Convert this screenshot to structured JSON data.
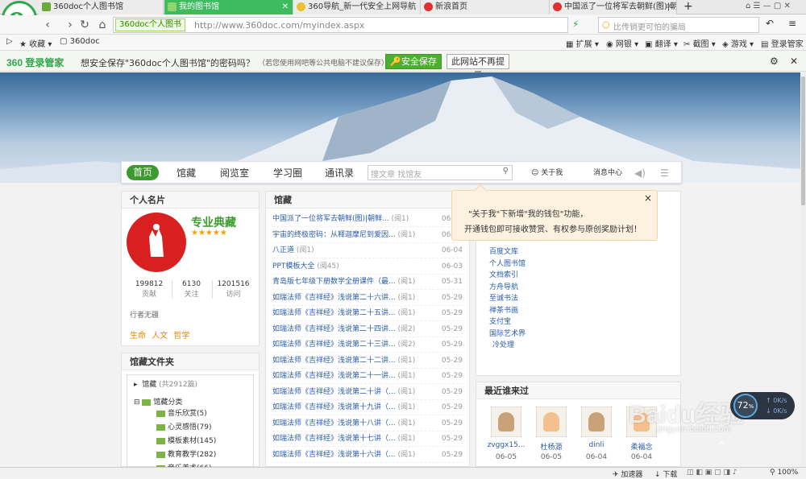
{
  "tabs": [
    {
      "label": "360doc个人图书馆",
      "active": false
    },
    {
      "label": "我的图书馆",
      "active": true
    },
    {
      "label": "360导航_新一代安全上网导航",
      "active": false
    },
    {
      "label": "新浪首页",
      "active": false
    },
    {
      "label": "中国派了一位将军去朝鲜(图)|朝鲜",
      "active": false
    }
  ],
  "address": {
    "site_badge": "360doc个人图书",
    "url": "http://www.360doc.com/myindex.aspx",
    "search_placeholder": "比传销更可怕的骗局"
  },
  "favbar": {
    "favorites": "收藏",
    "bookmark": "360doc",
    "extend": "扩展",
    "netbank": "网银",
    "translate": "翻译",
    "screenshot": "截图",
    "games": "游戏",
    "login_manager": "登录管家"
  },
  "notice": {
    "brand": "360 登录管家",
    "message": "想安全保存\"360doc个人图书馆\"的密码吗？",
    "submessage": "（若您使用网吧等公共电脑不建议保存）",
    "save_label": "安全保存",
    "nomore_label": "此网站不再提示"
  },
  "nav": {
    "home": "首页",
    "collection": "馆藏",
    "reading_room": "阅览室",
    "learning": "学习圈",
    "contacts": "通讯录",
    "search_placeholder": "搜文章 找馆友",
    "about_me": "关于我",
    "messages": "消息中心"
  },
  "profile": {
    "heading": "个人名片",
    "title": "专业典藏",
    "stats": [
      {
        "value": "199812",
        "label": "贡献"
      },
      {
        "value": "6130",
        "label": "关注"
      },
      {
        "value": "1201516",
        "label": "访问"
      }
    ],
    "motto": "行者无疆",
    "tags": [
      "生命",
      "人文",
      "哲学"
    ]
  },
  "folders": {
    "heading": "馆藏文件夹",
    "root": "馆藏",
    "root_count": "(共2912篇)",
    "category": "馆藏分类",
    "items": [
      "音乐欣赏(5)",
      "心灵感悟(79)",
      "模板素材(145)",
      "教育教学(282)",
      "音乐美术(66)"
    ]
  },
  "collection": {
    "heading": "馆藏",
    "rows": [
      {
        "title": "中国派了一位将军去朝鲜(图)|朝鲜...",
        "reads": "(阅1)",
        "date": "06-05"
      },
      {
        "title": "宇宙的终极密码：从释迦摩尼到爱因...",
        "reads": "(阅1)",
        "date": "06-05"
      },
      {
        "title": "八正道",
        "reads": "(阅1)",
        "date": "06-04"
      },
      {
        "title": "PPT模板大全",
        "reads": "(阅45)",
        "date": "06-03"
      },
      {
        "title": "青岛版七年级下册数学全册课件（最...",
        "reads": "(阅1)",
        "date": "05-31"
      },
      {
        "title": "如瑞法师《吉祥经》浅说第二十六讲...",
        "reads": "(阅1)",
        "date": "05-29"
      },
      {
        "title": "如瑞法师《吉祥经》浅说第二十五讲...",
        "reads": "(阅1)",
        "date": "05-29"
      },
      {
        "title": "如瑞法师《吉祥经》浅说第二十四讲...",
        "reads": "(阅2)",
        "date": "05-29"
      },
      {
        "title": "如瑞法师《吉祥经》浅说第二十三讲...",
        "reads": "(阅2)",
        "date": "05-29"
      },
      {
        "title": "如瑞法师《吉祥经》浅说第二十二讲...",
        "reads": "(阅1)",
        "date": "05-29"
      },
      {
        "title": "如瑞法师《吉祥经》浅说第二十一讲...",
        "reads": "(阅1)",
        "date": "05-29"
      },
      {
        "title": "如瑞法师《吉祥经》浅说第二十讲（...",
        "reads": "(阅1)",
        "date": "05-29"
      },
      {
        "title": "如瑞法师《吉祥经》浅说第十九讲（...",
        "reads": "(阅1)",
        "date": "05-29"
      },
      {
        "title": "如瑞法师《吉祥经》浅说第十八讲（...",
        "reads": "(阅1)",
        "date": "05-29"
      },
      {
        "title": "如瑞法师《吉祥经》浅说第十七讲（...",
        "reads": "(阅1)",
        "date": "05-29"
      },
      {
        "title": "如瑞法师《吉祥经》浅说第十六讲（...",
        "reads": "(阅1)",
        "date": "05-29"
      }
    ]
  },
  "popup": {
    "line1": "\"关于我\"下新增\"我的钱包\"功能，",
    "line2": "开通钱包即可接收赞赏、有权参与原创奖励计划！",
    "close": "×"
  },
  "links": [
    "百度文库",
    "个人图书馆",
    "文档索引",
    "方舟导航",
    "至诚书法",
    "禅茶书画",
    "支付宝",
    "国际艺术界",
    "冷处理"
  ],
  "visitors": {
    "heading": "最近谁来过",
    "items": [
      {
        "name": "zvggx15...",
        "date": "06-05"
      },
      {
        "name": "杜杨源",
        "date": "06-05"
      },
      {
        "name": "dinli",
        "date": "06-04"
      },
      {
        "name": "柔福念",
        "date": "06-04"
      }
    ]
  },
  "speed": {
    "value": "72",
    "unit": "%",
    "up": "0K/s",
    "down": "0K/s"
  },
  "status": {
    "accelerator": "加速器",
    "download": "下载",
    "zoom": "100%"
  },
  "watermark": "Baidu经验 jingyan.baidu.com",
  "colors": {
    "accent": "#3c9b2e",
    "link": "#2a5ba8",
    "tab_active": "#3dbb5e"
  }
}
